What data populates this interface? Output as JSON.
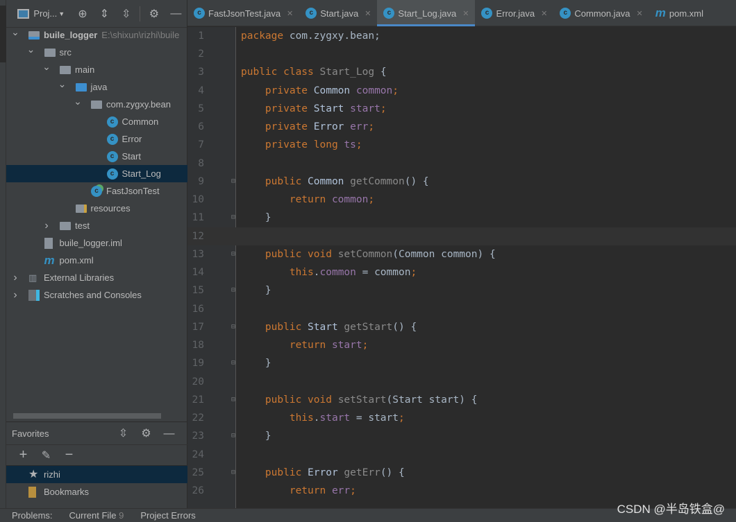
{
  "project_panel": {
    "title": "Proj...",
    "tools": [
      "locate-icon",
      "expand-all-icon",
      "collapse-all-icon",
      "gear-icon",
      "minimize-icon"
    ],
    "tree": [
      {
        "label": "buile_logger",
        "path": "E:\\shixun\\rizhi\\buile",
        "depth": 0,
        "icon": "module",
        "expanded": true,
        "bold": true
      },
      {
        "label": "src",
        "depth": 1,
        "icon": "folder",
        "expanded": true
      },
      {
        "label": "main",
        "depth": 2,
        "icon": "folder",
        "expanded": true
      },
      {
        "label": "java",
        "depth": 3,
        "icon": "source-folder",
        "expanded": true
      },
      {
        "label": "com.zygxy.bean",
        "depth": 4,
        "icon": "package",
        "expanded": true
      },
      {
        "label": "Common",
        "depth": 5,
        "icon": "class"
      },
      {
        "label": "Error",
        "depth": 5,
        "icon": "class"
      },
      {
        "label": "Start",
        "depth": 5,
        "icon": "class"
      },
      {
        "label": "Start_Log",
        "depth": 5,
        "icon": "class",
        "selected": true
      },
      {
        "label": "FastJsonTest",
        "depth": 4,
        "icon": "runnable-class"
      },
      {
        "label": "resources",
        "depth": 3,
        "icon": "resources-folder"
      },
      {
        "label": "test",
        "depth": 2,
        "icon": "folder",
        "expanded": false
      },
      {
        "label": "buile_logger.iml",
        "depth": 1,
        "icon": "iml"
      },
      {
        "label": "pom.xml",
        "depth": 1,
        "icon": "maven"
      },
      {
        "label": "External Libraries",
        "depth": 0,
        "icon": "libraries",
        "expanded": false
      },
      {
        "label": "Scratches and Consoles",
        "depth": 0,
        "icon": "scratches",
        "expanded": false
      }
    ]
  },
  "favorites": {
    "title": "Favorites",
    "items": [
      {
        "label": "rizhi",
        "icon": "star",
        "selected": true
      },
      {
        "label": "Bookmarks",
        "icon": "bookmark"
      }
    ]
  },
  "tabs": [
    {
      "label": "FastJsonTest.java",
      "icon": "runnable-class"
    },
    {
      "label": "Start.java",
      "icon": "class"
    },
    {
      "label": "Start_Log.java",
      "icon": "class",
      "active": true
    },
    {
      "label": "Error.java",
      "icon": "class"
    },
    {
      "label": "Common.java",
      "icon": "class"
    },
    {
      "label": "pom.xml",
      "icon": "maven"
    }
  ],
  "editor": {
    "current_line": 12,
    "lines": [
      [
        [
          "k",
          "package "
        ],
        [
          "p",
          "com.zygxy.bean;"
        ]
      ],
      [],
      [
        [
          "k",
          "public class "
        ],
        [
          "u",
          "Start_Log "
        ],
        [
          "p",
          "{"
        ]
      ],
      [
        [
          "k",
          "    private "
        ],
        [
          "t",
          "Common "
        ],
        [
          "f",
          "common"
        ],
        [
          "k",
          ";"
        ]
      ],
      [
        [
          "k",
          "    private "
        ],
        [
          "t",
          "Start "
        ],
        [
          "f",
          "start"
        ],
        [
          "k",
          ";"
        ]
      ],
      [
        [
          "k",
          "    private "
        ],
        [
          "t",
          "Error "
        ],
        [
          "f",
          "err"
        ],
        [
          "k",
          ";"
        ]
      ],
      [
        [
          "k",
          "    private long "
        ],
        [
          "f",
          "ts"
        ],
        [
          "k",
          ";"
        ]
      ],
      [],
      [
        [
          "k",
          "    public "
        ],
        [
          "t",
          "Common "
        ],
        [
          "u",
          "getCommon"
        ],
        [
          "p",
          "() {"
        ]
      ],
      [
        [
          "k",
          "        return "
        ],
        [
          "f",
          "common"
        ],
        [
          "k",
          ";"
        ]
      ],
      [
        [
          "p",
          "    }"
        ]
      ],
      [],
      [
        [
          "k",
          "    public void "
        ],
        [
          "u",
          "setCommon"
        ],
        [
          "p",
          "(Common common) {"
        ]
      ],
      [
        [
          "k",
          "        this"
        ],
        [
          "p",
          "."
        ],
        [
          "f",
          "common "
        ],
        [
          "p",
          "= common"
        ],
        [
          "k",
          ";"
        ]
      ],
      [
        [
          "p",
          "    }"
        ]
      ],
      [],
      [
        [
          "k",
          "    public "
        ],
        [
          "t",
          "Start "
        ],
        [
          "u",
          "getStart"
        ],
        [
          "p",
          "() {"
        ]
      ],
      [
        [
          "k",
          "        return "
        ],
        [
          "f",
          "start"
        ],
        [
          "k",
          ";"
        ]
      ],
      [
        [
          "p",
          "    }"
        ]
      ],
      [],
      [
        [
          "k",
          "    public void "
        ],
        [
          "u",
          "setStart"
        ],
        [
          "p",
          "(Start start) {"
        ]
      ],
      [
        [
          "k",
          "        this"
        ],
        [
          "p",
          "."
        ],
        [
          "f",
          "start "
        ],
        [
          "p",
          "= start"
        ],
        [
          "k",
          ";"
        ]
      ],
      [
        [
          "p",
          "    }"
        ]
      ],
      [],
      [
        [
          "k",
          "    public "
        ],
        [
          "t",
          "Error "
        ],
        [
          "u",
          "getErr"
        ],
        [
          "p",
          "() {"
        ]
      ],
      [
        [
          "k",
          "        return "
        ],
        [
          "f",
          "err"
        ],
        [
          "k",
          ";"
        ]
      ]
    ],
    "fold_lines": [
      9,
      11,
      13,
      15,
      17,
      19,
      21,
      23,
      25
    ]
  },
  "status": {
    "problems": "Problems:",
    "current_file": "Current File",
    "current_file_count": "9",
    "project_errors": "Project Errors"
  },
  "watermark": "CSDN @半岛铁盒@"
}
